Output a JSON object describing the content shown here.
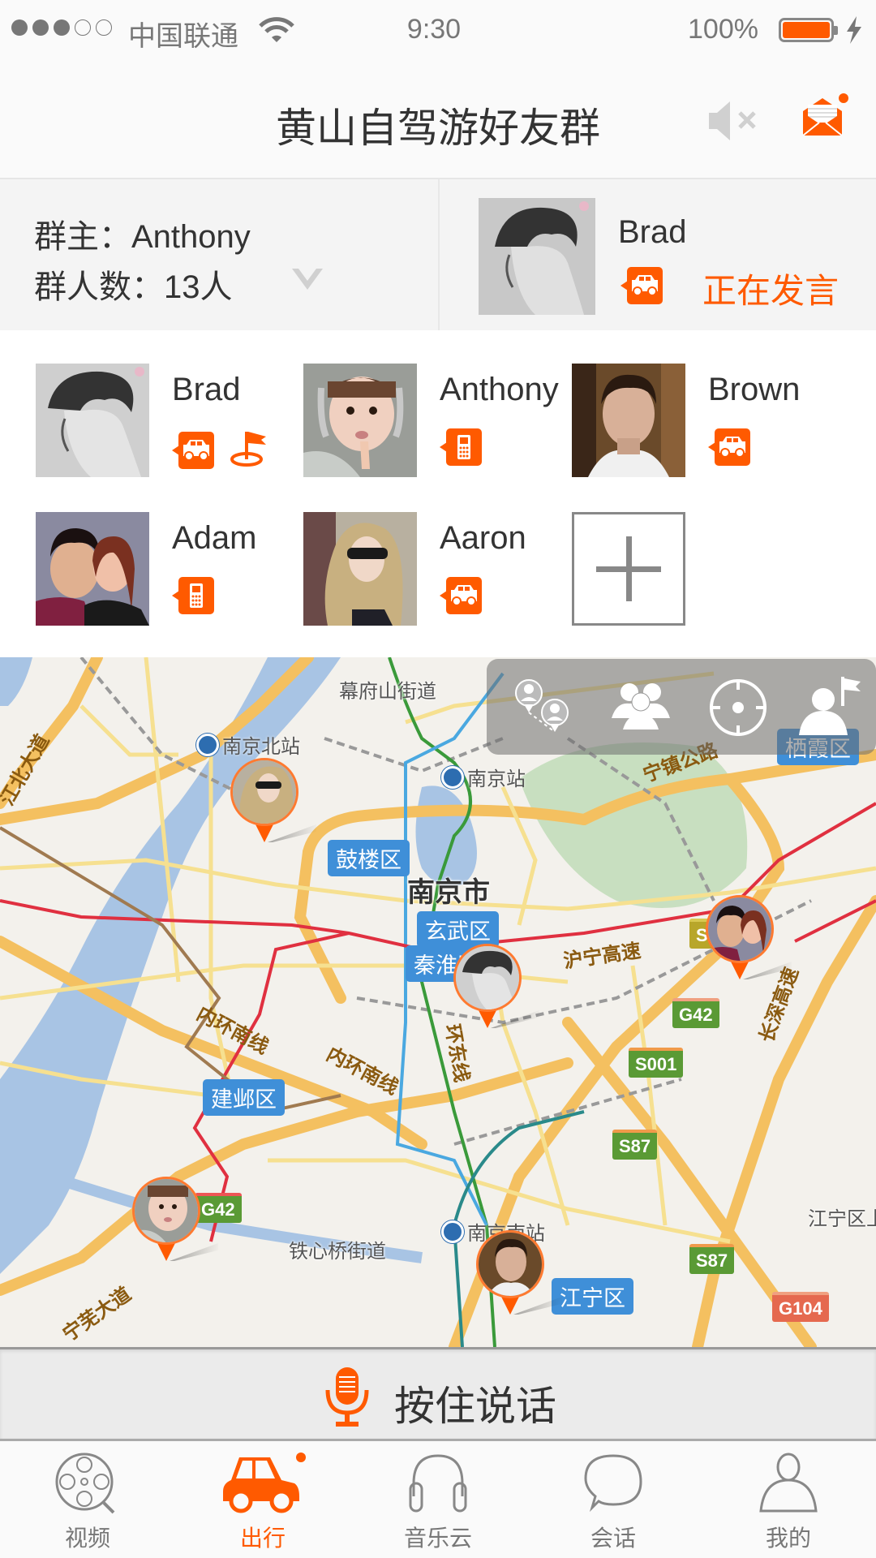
{
  "status_bar": {
    "signal_filled": 3,
    "signal_total": 5,
    "carrier": "中国联通",
    "time": "9:30",
    "battery_percent_label": "100%",
    "battery_level": 1.0,
    "charging": true
  },
  "header": {
    "title": "黄山自驾游好友群",
    "icons": [
      "mute-icon",
      "mail-icon"
    ],
    "mail_has_notification": true
  },
  "group_info": {
    "owner_label": "群主：Anthony",
    "count_label": "群人数：13人",
    "expand_icon": "chevron-down-icon",
    "current_speaker": {
      "name": "Brad",
      "badge": "car",
      "status": "正在发言"
    }
  },
  "members": [
    {
      "name": "Brad",
      "badges": [
        "car",
        "flag"
      ]
    },
    {
      "name": "Anthony",
      "badges": [
        "phone"
      ]
    },
    {
      "name": "Brown",
      "badges": [
        "car"
      ]
    },
    {
      "name": "Adam",
      "badges": [
        "phone"
      ]
    },
    {
      "name": "Aaron",
      "badges": [
        "car"
      ]
    }
  ],
  "add_member_icon": "plus-icon",
  "map": {
    "tools": [
      "member-distance-icon",
      "group-members-icon",
      "locate-icon",
      "set-destination-icon"
    ],
    "labels": {
      "mufushan": "幕府山街道",
      "nanjing_north": "南京北站",
      "nanjing_station": "南京站",
      "gulou": "鼓楼区",
      "nanjing_city": "南京市",
      "xuanwu": "玄武区",
      "qinhuai": "秦淮区",
      "jianye": "建邺区",
      "tiexinqiao": "铁心桥街道",
      "nanjing_south": "南京南站",
      "jiangning": "江宁区",
      "jiangning_town": "江宁区上",
      "qixia": "栖霞区",
      "huning": "沪宁高速",
      "neihuan_south1": "内环南线",
      "neihuan_south2": "内环南线",
      "huandong": "环东线",
      "jiangbei": "江北大道",
      "ningwu": "宁芜大道",
      "ningjing": "宁镇公路",
      "changshen": "长深高速"
    },
    "shields": {
      "g42_a": "G42",
      "g42_b": "G42",
      "s001": "S001",
      "s87_a": "S87",
      "s87_b": "S87",
      "g104": "G104",
      "s1": "S1"
    },
    "pins": [
      "Aaron",
      "Brad",
      "Adam",
      "Anthony",
      "Brown"
    ]
  },
  "talk_button": {
    "label": "按住说话",
    "icon": "microphone-icon"
  },
  "tabs": [
    {
      "label": "视频",
      "icon": "film-reel-icon",
      "active": false
    },
    {
      "label": "出行",
      "icon": "car-icon",
      "active": true,
      "badge_dot": true
    },
    {
      "label": "音乐云",
      "icon": "headphones-icon",
      "active": false
    },
    {
      "label": "会话",
      "icon": "chat-bubble-icon",
      "active": false
    },
    {
      "label": "我的",
      "icon": "person-icon",
      "active": false
    }
  ],
  "colors": {
    "accent": "#ff5a00",
    "text": "#333333",
    "muted": "#777777",
    "district_blue": "#3f8fd8"
  }
}
